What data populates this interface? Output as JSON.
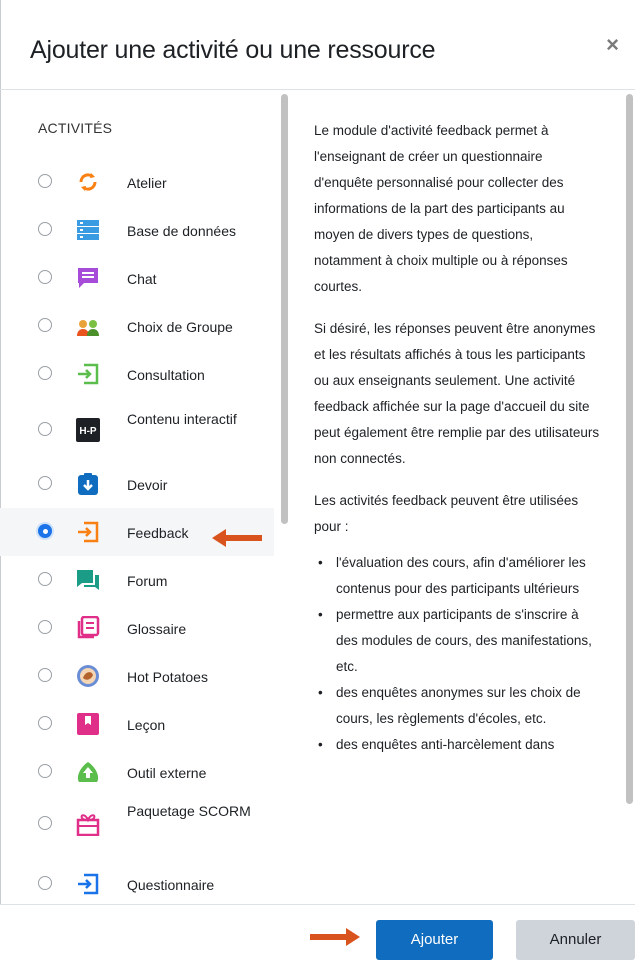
{
  "dialog": {
    "title": "Ajouter une activité ou une ressource",
    "close_symbol": "×"
  },
  "activities": {
    "section_label": "ACTIVITÉS",
    "items": [
      {
        "label": "Atelier",
        "icon": "workshop-icon",
        "selected": false
      },
      {
        "label": "Base de données",
        "icon": "database-icon",
        "selected": false
      },
      {
        "label": "Chat",
        "icon": "chat-icon",
        "selected": false
      },
      {
        "label": "Choix de Groupe",
        "icon": "group-choice-icon",
        "selected": false
      },
      {
        "label": "Consultation",
        "icon": "consultation-icon",
        "selected": false
      },
      {
        "label": "Contenu interactif",
        "icon": "h5p-icon",
        "icon_text": "H-P",
        "selected": false
      },
      {
        "label": "Devoir",
        "icon": "assignment-icon",
        "selected": false
      },
      {
        "label": "Feedback",
        "icon": "feedback-icon",
        "selected": true
      },
      {
        "label": "Forum",
        "icon": "forum-icon",
        "selected": false
      },
      {
        "label": "Glossaire",
        "icon": "glossary-icon",
        "selected": false
      },
      {
        "label": "Hot Potatoes",
        "icon": "hotpot-icon",
        "selected": false
      },
      {
        "label": "Leçon",
        "icon": "lesson-icon",
        "selected": false
      },
      {
        "label": "Outil externe",
        "icon": "external-tool-icon",
        "selected": false
      },
      {
        "label": "Paquetage SCORM",
        "icon": "scorm-icon",
        "selected": false
      },
      {
        "label": "Questionnaire",
        "icon": "questionnaire-icon",
        "selected": false
      }
    ]
  },
  "description": {
    "p1": "Le module d'activité feedback permet à l'enseignant de créer un questionnaire d'enquête personnalisé pour collecter des informations de la part des participants au moyen de divers types de questions, notamment à choix multiple ou à réponses courtes.",
    "p2": "Si désiré, les réponses peuvent être anonymes et les résultats affichés à tous les participants ou aux enseignants seulement. Une activité feedback affichée sur la page d'accueil du site peut également être remplie par des utilisateurs non connectés.",
    "p3": "Les activités feedback peuvent être utilisées pour :",
    "bullets": [
      "l'évaluation des cours, afin d'améliorer les contenus pour des participants ultérieurs",
      "permettre aux participants de s'inscrire à des modules de cours, des manifestations, etc.",
      "des enquêtes anonymes sur les choix de cours, les règlements d'écoles, etc.",
      "des enquêtes anti-harcèlement dans"
    ]
  },
  "footer": {
    "add_label": "Ajouter",
    "cancel_label": "Annuler"
  },
  "colors": {
    "primary": "#0f6cbf",
    "annotation_arrow": "#d9531e",
    "radio_selected": "#1a73e8"
  }
}
